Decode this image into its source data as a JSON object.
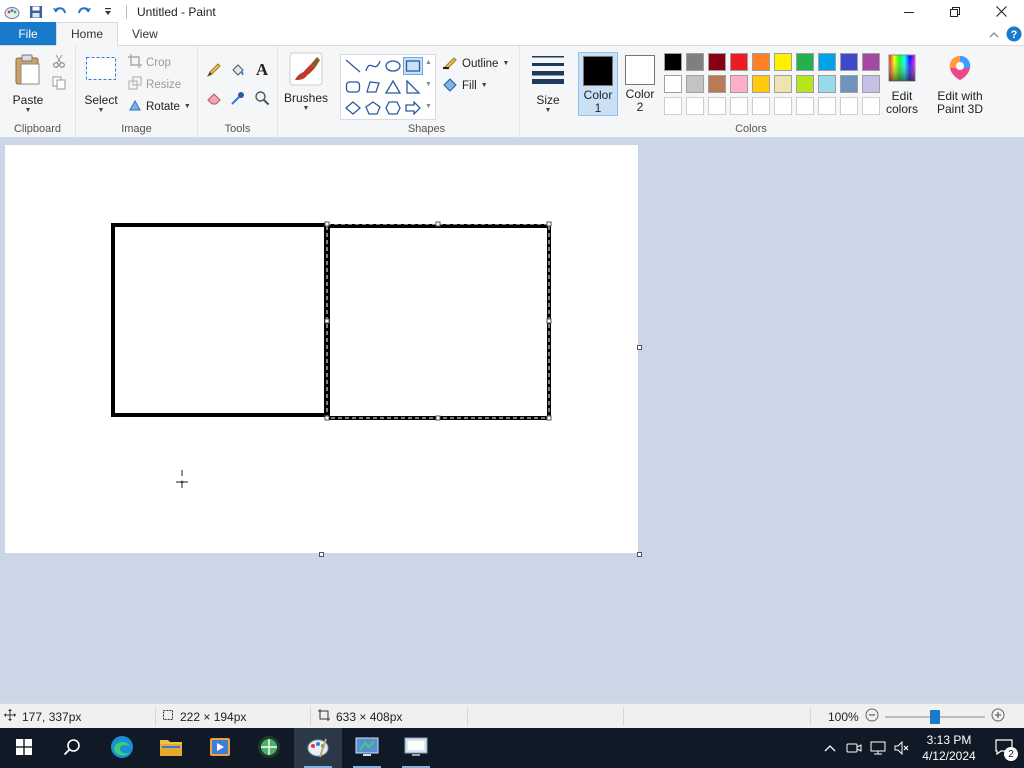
{
  "window": {
    "title": "Untitled - Paint",
    "controls": {
      "minimize": "minimize-icon",
      "maximize": "restore-icon",
      "close": "close-icon"
    }
  },
  "tabs": {
    "file": "File",
    "home": "Home",
    "view": "View"
  },
  "ribbon": {
    "clipboard": {
      "label": "Clipboard",
      "paste": "Paste"
    },
    "image": {
      "label": "Image",
      "select": "Select",
      "crop": "Crop",
      "resize": "Resize",
      "rotate": "Rotate"
    },
    "tools": {
      "label": "Tools"
    },
    "brushes": {
      "label": "Brushes"
    },
    "shapes": {
      "label": "Shapes",
      "outline": "Outline",
      "fill": "Fill"
    },
    "size": {
      "label": "Size"
    },
    "colors": {
      "label": "Colors",
      "color1": "Color 1",
      "color2": "Color 2",
      "color1_value": "#000000",
      "color2_value": "#ffffff",
      "edit_colors": "Edit colors",
      "paint3d": "Edit with Paint 3D",
      "palette_row1": [
        "#000000",
        "#7f7f7f",
        "#880015",
        "#ed1c24",
        "#ff7f27",
        "#fff200",
        "#22b14c",
        "#00a2e8",
        "#3f48cc",
        "#a349a4"
      ],
      "palette_row2": [
        "#ffffff",
        "#c3c3c3",
        "#b97a57",
        "#ffaec9",
        "#ffc90e",
        "#efe4b0",
        "#b5e61d",
        "#99d9ea",
        "#7092be",
        "#c8bfe7"
      ]
    }
  },
  "status": {
    "cursor_pos": "177, 337px",
    "selection_size": "222 × 194px",
    "canvas_size": "633 × 408px",
    "zoom": "100%",
    "zoom_fraction": 0.5
  },
  "taskbar": {
    "time": "3:13 PM",
    "date": "4/12/2024",
    "notifications": "2"
  }
}
